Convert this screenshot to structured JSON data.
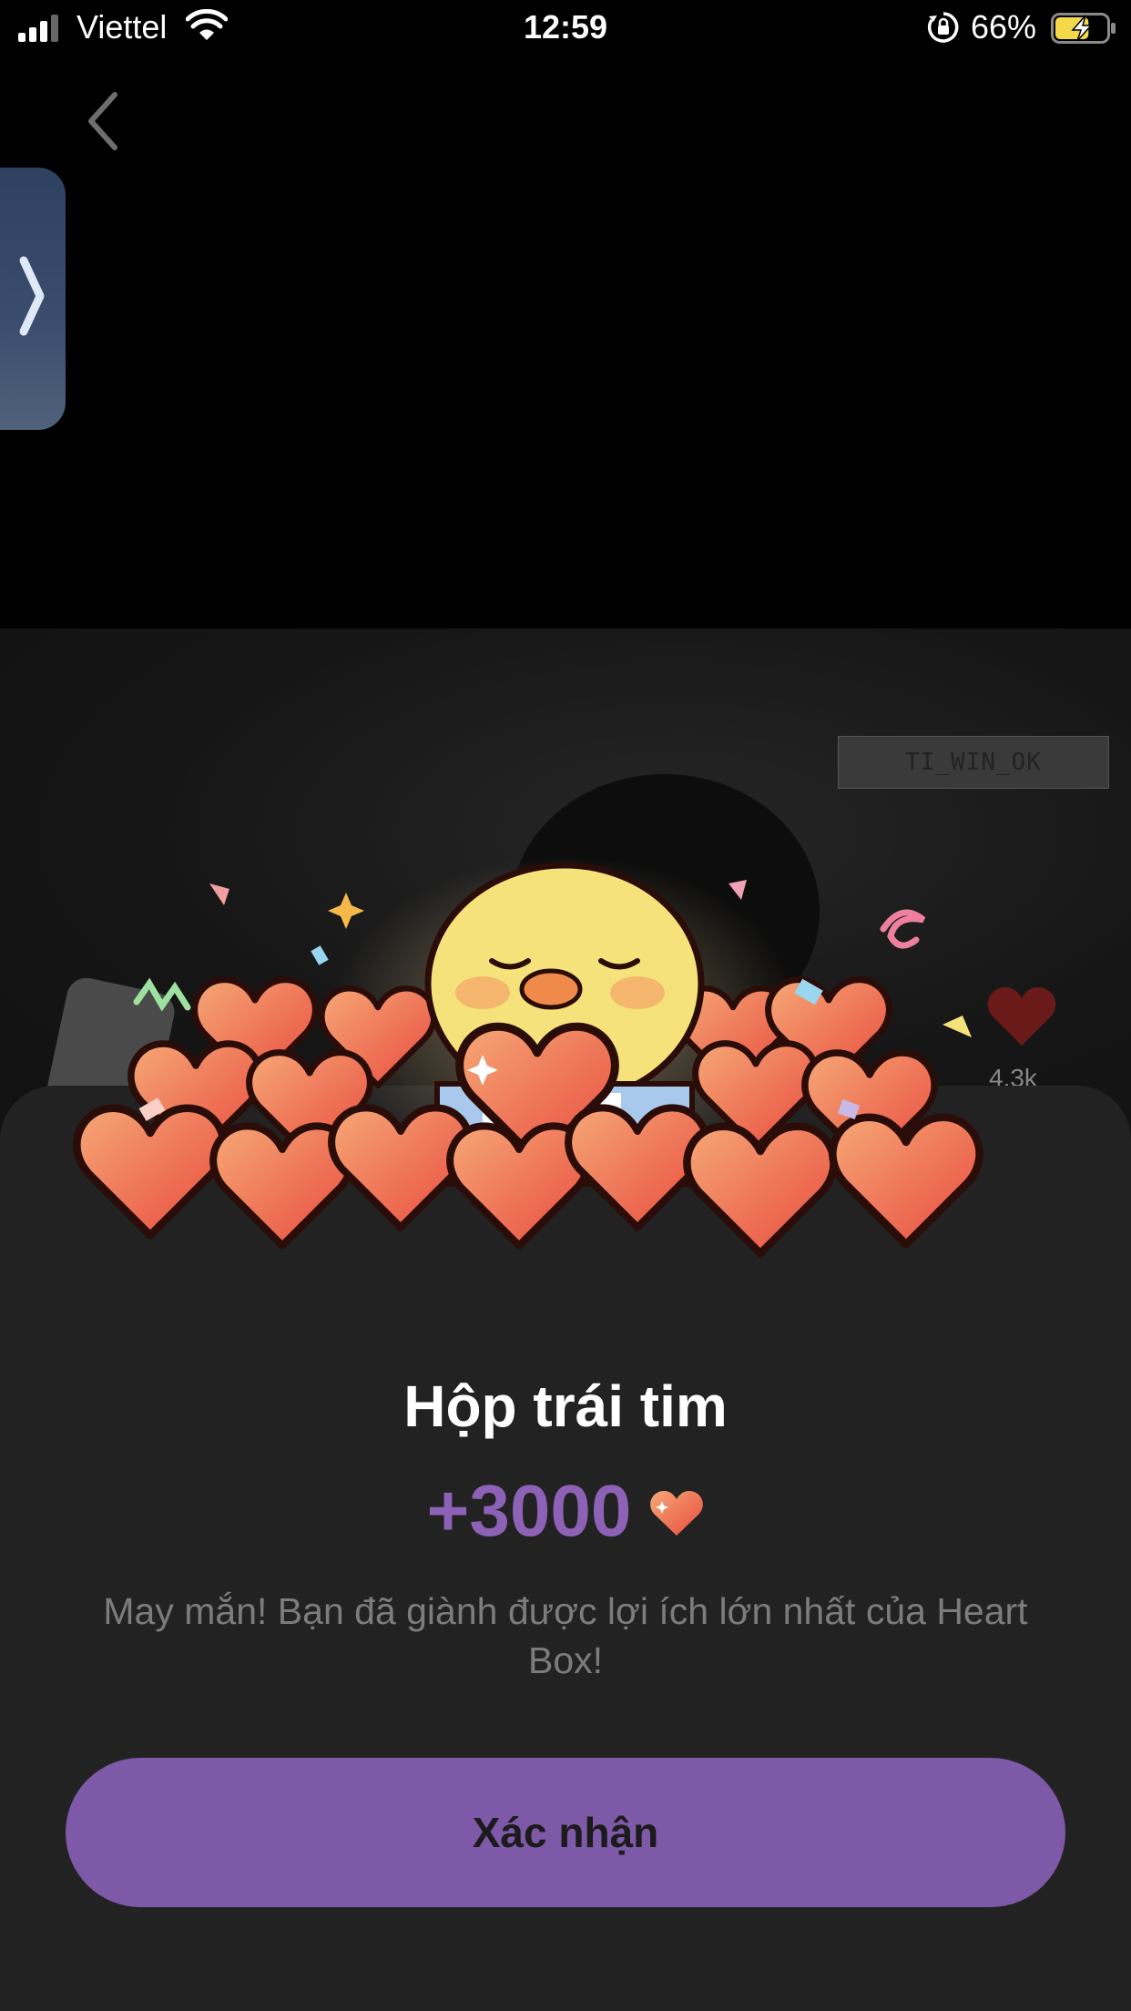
{
  "status_bar": {
    "carrier": "Viettel",
    "time": "12:59",
    "battery_percent": "66%",
    "battery_level": 0.66
  },
  "video": {
    "username": "TI_WIN_OK",
    "like_count": "4.3k"
  },
  "dialog": {
    "title": "Hộp trái tim",
    "reward_amount": "+3000",
    "description": "May mắn! Bạn đã giành được lợi ích lớn nhất của Heart Box!",
    "confirm_label": "Xác nhận"
  },
  "colors": {
    "accent": "#7e59a8",
    "reward_text": "#8d62b6",
    "sheet_bg": "#222222",
    "heart": "#ea5a48"
  },
  "icons": [
    "signal-icon",
    "wifi-icon",
    "orientation-lock-icon",
    "battery-charging-icon",
    "back-chevron-icon",
    "chevron-right-icon",
    "heart-icon"
  ]
}
